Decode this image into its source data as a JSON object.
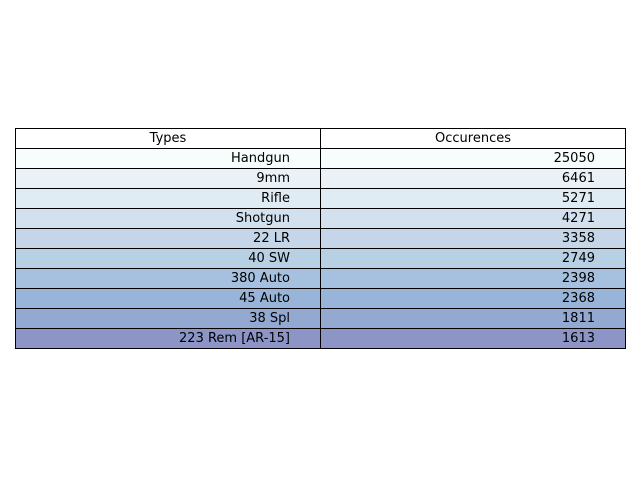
{
  "chart_data": {
    "type": "table",
    "columns": [
      "Types",
      "Occurences"
    ],
    "rows": [
      {
        "type": "Handgun",
        "occurrences": 25050,
        "color": "#f7fcfd"
      },
      {
        "type": "9mm",
        "occurrences": 6461,
        "color": "#eaf2f7"
      },
      {
        "type": "Rifle",
        "occurrences": 5271,
        "color": "#e0ecf4"
      },
      {
        "type": "Shotgun",
        "occurrences": 4271,
        "color": "#d3e1ee"
      },
      {
        "type": "22 LR",
        "occurrences": 3358,
        "color": "#c4d6e8"
      },
      {
        "type": "40 SW",
        "occurrences": 2749,
        "color": "#b7d0e3"
      },
      {
        "type": "380 Auto",
        "occurrences": 2398,
        "color": "#a5c1df"
      },
      {
        "type": "45 Auto",
        "occurrences": 2368,
        "color": "#98b5d9"
      },
      {
        "type": "38 Spl",
        "occurrences": 1811,
        "color": "#94a9d2"
      },
      {
        "type": "223 Rem [AR-15]",
        "occurrences": 1613,
        "color": "#8c95c6"
      }
    ]
  }
}
